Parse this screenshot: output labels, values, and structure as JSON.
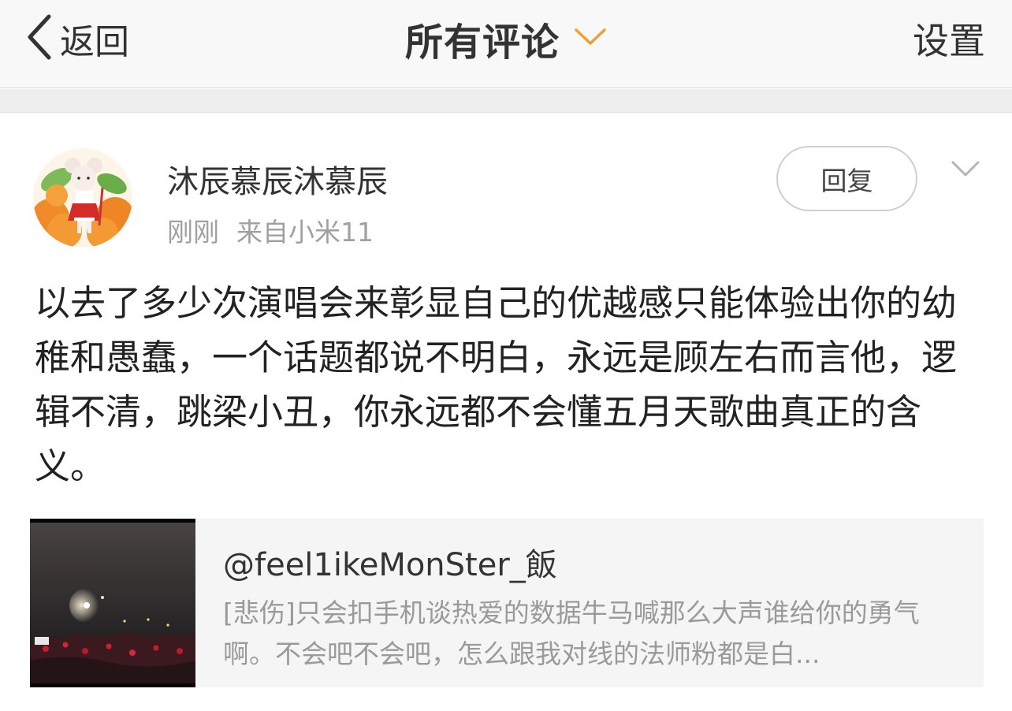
{
  "nav": {
    "back_label": "返回",
    "title": "所有评论",
    "settings_label": "设置"
  },
  "comment": {
    "username": "沐辰慕辰沐慕辰",
    "time": "刚刚",
    "source": "来自小米11",
    "reply_label": "回复",
    "text": "以去了多少次演唱会来彰显自己的优越感只能体验出你的幼稚和愚蠢，一个话题都说不明白，永远是顾左右而言他，逻辑不清，跳梁小丑，你永远都不会懂五月天歌曲真正的含义。"
  },
  "quoted_post": {
    "author": "@feel1ikeMonSter_飯",
    "text": "[悲伤]只会扣手机谈热爱的数据牛马喊那么大声谁给你的勇气啊。不会吧不会吧，怎么跟我对线的法师粉都是白..."
  },
  "colors": {
    "accent_chevron": "#f0a030",
    "nav_background": "#f8f8f8",
    "secondary_text": "#a0a0a0"
  },
  "icons": {
    "back": "chevron-left-icon",
    "title_dropdown": "chevron-down-icon",
    "comment_menu": "chevron-down-icon"
  }
}
